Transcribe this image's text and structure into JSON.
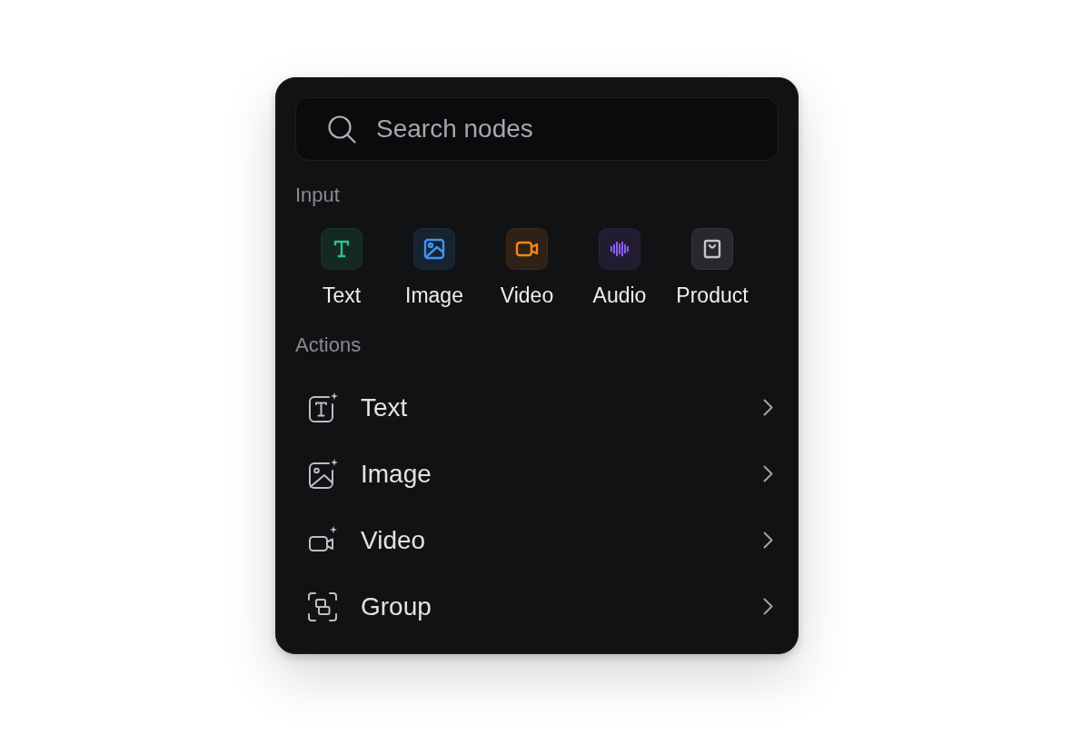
{
  "search": {
    "placeholder": "Search nodes"
  },
  "input_section": {
    "title": "Input",
    "items": [
      {
        "label": "Text",
        "color": "#2ec28e"
      },
      {
        "label": "Image",
        "color": "#3d95f5"
      },
      {
        "label": "Video",
        "color": "#f5861f"
      },
      {
        "label": "Audio",
        "color": "#8b5cf6"
      },
      {
        "label": "Product",
        "color": "#c4c4c9"
      }
    ]
  },
  "actions_section": {
    "title": "Actions",
    "items": [
      {
        "label": "Text"
      },
      {
        "label": "Image"
      },
      {
        "label": "Video"
      },
      {
        "label": "Group"
      }
    ]
  }
}
